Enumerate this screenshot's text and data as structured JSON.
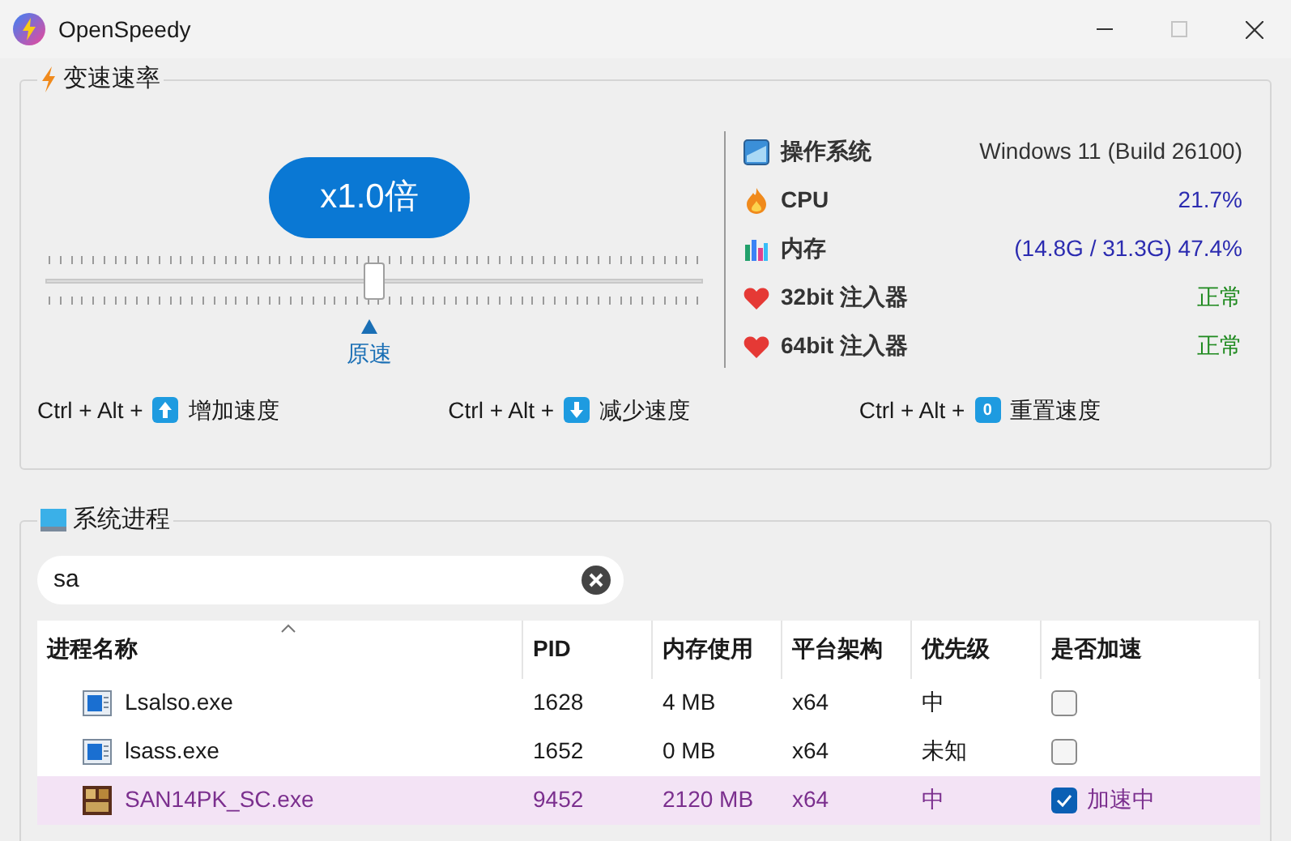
{
  "window": {
    "title": "OpenSpeedy",
    "maximize_disabled": true
  },
  "speed_group": {
    "title": "变速速率",
    "speed_label": "x1.0倍",
    "slider": {
      "level": 0.5
    },
    "marker_label": "原速",
    "system_info": [
      {
        "kind": "os",
        "label": "操作系统",
        "value": "Windows 11 (Build 26100)"
      },
      {
        "kind": "cpu",
        "label": "CPU",
        "value": "21.7%"
      },
      {
        "kind": "memory",
        "label": "内存",
        "value": "(14.8G / 31.3G) 47.4%"
      },
      {
        "kind": "injector",
        "label": "32bit 注入器",
        "value": "正常"
      },
      {
        "kind": "injector",
        "label": "64bit 注入器",
        "value": "正常"
      }
    ],
    "hotkeys": [
      {
        "kind": "up",
        "combo": "Ctrl + Alt +",
        "action": "增加速度"
      },
      {
        "kind": "down",
        "combo": "Ctrl + Alt +",
        "action": "减少速度"
      },
      {
        "kind": "label",
        "combo": "Ctrl + Alt +",
        "key_label": "0",
        "action": "重置速度"
      }
    ]
  },
  "process_group": {
    "title": "系统进程",
    "search": {
      "value": "sa"
    },
    "table": {
      "columns": [
        {
          "label": "进程名称",
          "sorted": true
        },
        {
          "label": "PID",
          "sorted": false
        },
        {
          "label": "内存使用",
          "sorted": false
        },
        {
          "label": "平台架构",
          "sorted": false
        },
        {
          "label": "优先级",
          "sorted": false
        },
        {
          "label": "是否加速",
          "sorted": false
        }
      ],
      "rows": [
        {
          "kind": "app",
          "name": "Lsalso.exe",
          "pid": "1628",
          "memory": "4 MB",
          "arch": "x64",
          "priority": "中",
          "checked": false,
          "selected": false
        },
        {
          "kind": "app",
          "name": "lsass.exe",
          "pid": "1652",
          "memory": "0 MB",
          "arch": "x64",
          "priority": "未知",
          "checked": false,
          "selected": false
        },
        {
          "kind": "game",
          "name": "SAN14PK_SC.exe",
          "pid": "9452",
          "memory": "2120 MB",
          "arch": "x64",
          "priority": "中",
          "checked": true,
          "status": "加速中",
          "selected": true
        }
      ]
    }
  }
}
